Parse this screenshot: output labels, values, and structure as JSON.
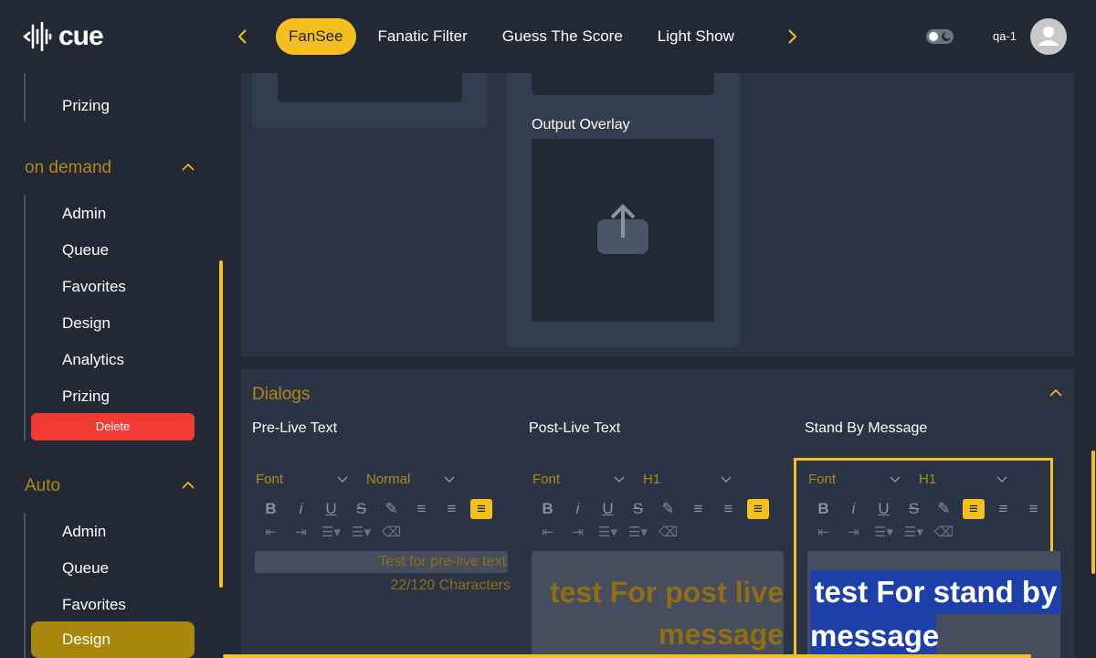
{
  "header": {
    "logo_text": "cue",
    "tabs": [
      {
        "label": "FanSee",
        "active": true
      },
      {
        "label": "Fanatic Filter",
        "active": false
      },
      {
        "label": "Guess The Score",
        "active": false
      },
      {
        "label": "Light Show",
        "active": false
      }
    ],
    "user_label": "qa-1"
  },
  "sidebar": {
    "top_item": "Prizing",
    "sections": [
      {
        "title": "on demand",
        "items": [
          "Admin",
          "Queue",
          "Favorites",
          "Design",
          "Analytics",
          "Prizing"
        ],
        "delete_label": "Delete"
      },
      {
        "title": "Auto",
        "items": [
          "Admin",
          "Queue",
          "Favorites",
          "Design"
        ],
        "active_item": "Design"
      }
    ]
  },
  "main": {
    "output_overlay_label": "Output Overlay",
    "dialogs": {
      "title": "Dialogs",
      "columns": [
        {
          "label": "Pre-Live Text",
          "font": "Font",
          "size": "Normal",
          "text": "Test for pre-live text",
          "char_count": "22/120 Characters"
        },
        {
          "label": "Post-Live Text",
          "font": "Font",
          "size": "H1",
          "text_line1": "test For post live",
          "text_line2": "message"
        },
        {
          "label": "Stand By Message",
          "font": "Font",
          "size": "H1",
          "text_line1": "test For stand by",
          "text_line2": "message"
        }
      ]
    }
  },
  "colors": {
    "accent": "#f4c020",
    "background": "#222834",
    "panel": "#2b3444",
    "section_title": "#b08a14",
    "delete": "#f03a32",
    "selection": "#1c3fa8"
  }
}
